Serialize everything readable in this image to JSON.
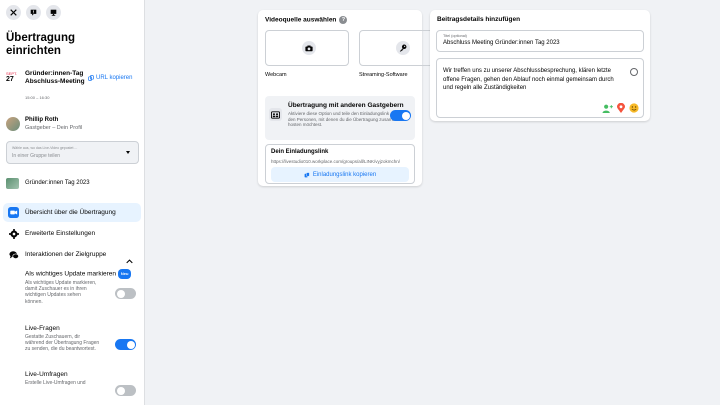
{
  "sidebar": {
    "title": "Übertragung einrichten",
    "event": {
      "month": "SEPT.",
      "day": "27",
      "name": "Gründer:innen-Tag Abschluss-Meeting",
      "time": "15:00 – 16:30",
      "copy_label": "URL kopieren"
    },
    "user": {
      "name": "Phillip Roth",
      "subtitle": "Gastgeber – Dein Profil"
    },
    "select": {
      "label": "Wähle aus, wo das Live-Video gepostet ...",
      "value": "In einer Gruppe teilen"
    },
    "group_name": "Gründer:innen Tag 2023",
    "nav": {
      "overview": "Übersicht über die Übertragung",
      "advanced": "Erweiterte Einstellungen",
      "audience": "Interaktionen der Zielgruppe"
    },
    "settings": [
      {
        "title": "Als wichtiges Update markieren",
        "badge": "Neu",
        "desc": "Als wichtiges Update markieren, damit Zuschauer es in ihren wichtigen Updates sehen können.",
        "on": false
      },
      {
        "title": "Live-Fragen",
        "desc": "Gestatte Zuschauern, dir während der Übertragung Fragen zu senden, die du beantwortest.",
        "on": true
      },
      {
        "title": "Live-Umfragen",
        "desc": "Erstelle Live-Umfragen und",
        "on": false
      }
    ]
  },
  "video_source": {
    "title": "Videoquelle auswählen",
    "help": "?",
    "options": [
      "Webcam",
      "Streaming-Software"
    ],
    "guests": {
      "title": "Übertragung mit anderen Gastgebern",
      "desc": "Aktiviere diese Option und teile den Einladungslink dann mit den Personen, mit denen du die Übertragung zusammen hosten möchtest.",
      "on": true
    },
    "invite": {
      "title": "Dein Einladungslink",
      "url": "https://livestudio010.workplace.com/groups/all/LINK/vyjzokmchn/",
      "button": "Einladungslink kopieren"
    }
  },
  "post_details": {
    "title": "Beitragsdetails hinzufügen",
    "title_field_label": "Titel (optional)",
    "title_value": "Abschluss Meeting Gründer:innen Tag 2023",
    "description": "Wir treffen uns zu unserer Abschlussbesprechung, klären letzte offene Fragen, gehen den Ablauf noch einmal gemeinsam durch und regeln alle Zuständigkeiten"
  },
  "colors": {
    "accent": "#1877f2",
    "background": "#f0f2f5"
  }
}
